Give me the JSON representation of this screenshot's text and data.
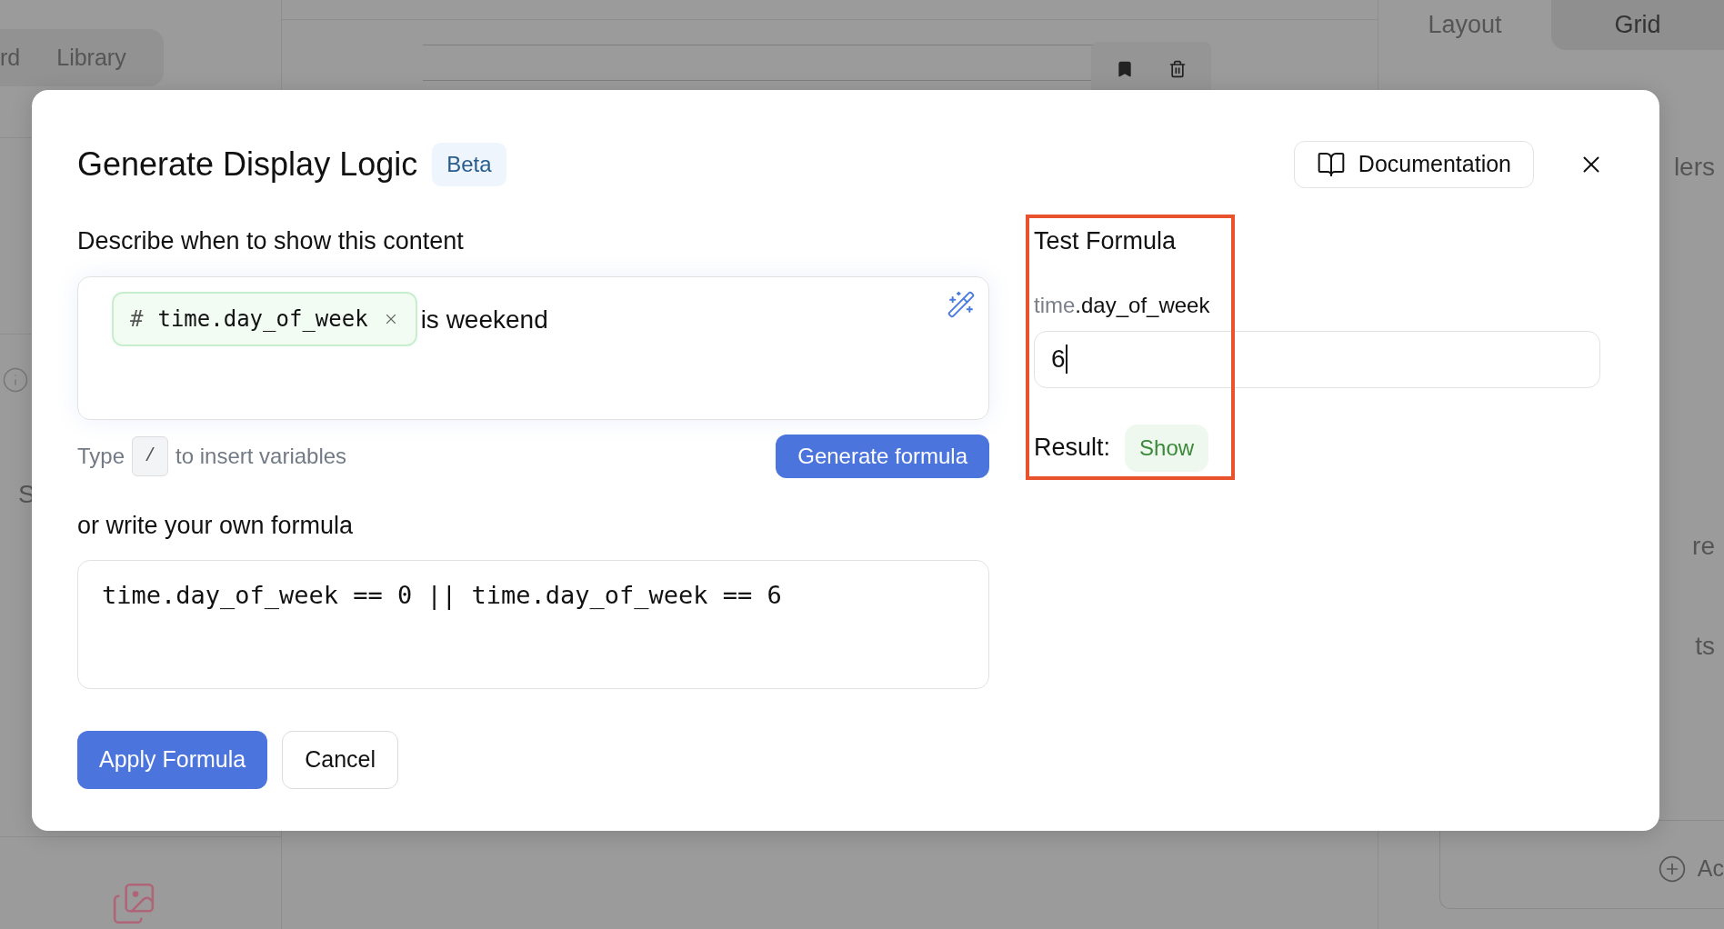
{
  "background": {
    "nav_tabs": [
      "rd",
      "Library"
    ],
    "panel_tabs": [
      {
        "label": "Layout",
        "selected": false
      },
      {
        "label": "Grid",
        "selected": true
      }
    ],
    "side_letter": "S",
    "panel_fragments": [
      "lers",
      "re",
      "ts"
    ],
    "add_label": "Ac"
  },
  "dialog": {
    "title": "Generate Display Logic",
    "badge": "Beta",
    "docs_button": "Documentation",
    "describe": {
      "label": "Describe when to show this content",
      "chip_symbol": "#",
      "chip_variable": "time.day_of_week",
      "text": "is weekend",
      "hint_before": "Type",
      "hint_key": "/",
      "hint_after": "to insert variables",
      "generate_button": "Generate formula"
    },
    "formula": {
      "label": "or write your own formula",
      "value": "time.day_of_week == 0 || time.day_of_week == 6"
    },
    "test": {
      "title": "Test Formula",
      "highlighted": true,
      "var_prefix": "time",
      "var_name": ".day_of_week",
      "value": "6",
      "result_label": "Result:",
      "result": "Show"
    },
    "buttons": [
      "Apply Formula",
      "Cancel"
    ]
  }
}
